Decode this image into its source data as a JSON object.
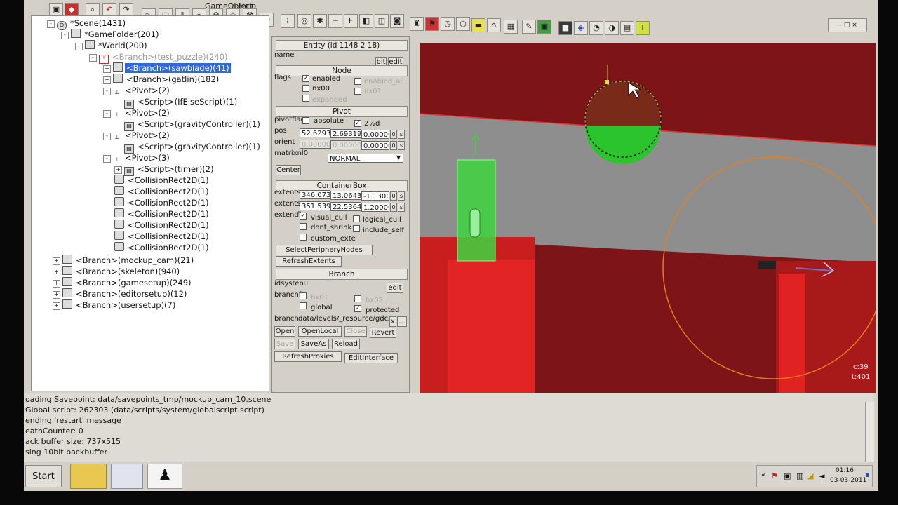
{
  "menu": {
    "gameobject": "GameObject",
    "help": "Help"
  },
  "tree": {
    "nodes": [
      {
        "label": "*Scene(1431)"
      },
      {
        "label": "*GameFolder(201)"
      },
      {
        "label": "*World(200)"
      },
      {
        "label": "<Branch>(test_puzzle)(240)"
      },
      {
        "label": "<Branch>(sawblade)(41)"
      },
      {
        "label": "<Branch>(gatlin)(182)"
      },
      {
        "label": "<Pivot>(2)"
      },
      {
        "label": "<Script>(IfElseScript)(1)"
      },
      {
        "label": "<Pivot>(2)"
      },
      {
        "label": "<Script>(gravityController)(1)"
      },
      {
        "label": "<Pivot>(2)"
      },
      {
        "label": "<Script>(gravityController)(1)"
      },
      {
        "label": "<Pivot>(3)"
      },
      {
        "label": "<Script>(timer)(2)"
      },
      {
        "label": "<CollisionRect2D(1)"
      },
      {
        "label": "<CollisionRect2D(1)"
      },
      {
        "label": "<CollisionRect2D(1)"
      },
      {
        "label": "<CollisionRect2D(1)"
      },
      {
        "label": "<CollisionRect2D(1)"
      },
      {
        "label": "<CollisionRect2D(1)"
      },
      {
        "label": "<CollisionRect2D(1)"
      },
      {
        "label": "<Branch>(mockup_cam)(21)"
      },
      {
        "label": "<Branch>(skeleton)(940)"
      },
      {
        "label": "<Branch>(gamesetup)(249)"
      },
      {
        "label": "<Branch>(editorsetup)(12)"
      },
      {
        "label": "<Branch>(usersetup)(7)"
      }
    ]
  },
  "props": {
    "entity_title": "Entity (id 1148 2 18)",
    "name_label": "name",
    "bit_btn": "bit",
    "edit_btn": "edit",
    "node_hdr": "Node",
    "flags_label": "flags",
    "enabled": "enabled",
    "enabled_all": "enabled_all",
    "nx00": "nx00",
    "nx01": "nx01",
    "expanded": "expanded",
    "pivot_hdr": "Pivot",
    "pivotflag_label": "pivotflag",
    "absolute": "absolute",
    "is2d": "2½d",
    "pos_label": "pos",
    "pos": [
      "52.6293",
      "2.69319",
      "0.00000"
    ],
    "orient_label": "orient",
    "orient": [
      "0.00000",
      "0.00000",
      "0.00000"
    ],
    "matrix_label": "matrixnl0",
    "matrix_value": "NORMAL",
    "center_btn": "Center",
    "container_hdr": "ContainerBox",
    "extents_label_1": "extentsr",
    "extents_1": [
      "346.073",
      "13.0643",
      "-1.13000"
    ],
    "extents_label_2": "extentsr",
    "extents_2": [
      "351.539",
      "22.5364",
      "1.20000"
    ],
    "extentfl_label": "extentfl",
    "visual_cull": "visual_cull",
    "logical_cull": "logical_cull",
    "dont_shrink": "dont_shrink",
    "include_self": "include_self",
    "custom_exte": "custom_exte",
    "select_periphery_btn": "SelectPeripheryNodes",
    "refresh_extents_btn": "RefreshExtents",
    "branch_hdr": "Branch",
    "idsystem_label": "idsysten",
    "idsystem_value": "10",
    "edit_btn2": "edit",
    "branchf_label": "branchf",
    "bx01": "bx01",
    "bx02": "bx02",
    "global": "global",
    "protected": "protected",
    "branch_label": "branch",
    "branch_path": "data/levels/_resource/gdc/",
    "x_btn": "x",
    "dots_btn": "...",
    "open_btn": "Open",
    "open_local_btn": "OpenLocal",
    "close_btn": "Close",
    "revert_btn": "Revert",
    "save_btn": "Save",
    "save_as_btn": "SaveAs",
    "reload_btn": "Reload",
    "refresh_proxies_btn": "RefreshProxies",
    "edit_interface_btn": "EditInterface",
    "s_btn": "s",
    "zero_btn": "0"
  },
  "viewport": {
    "stat1": "c:39",
    "stat2": "t:401"
  },
  "console": {
    "lines": [
      "oading Savepoint: data/savepoints_tmp/mockup_cam_10.scene",
      "Global script: 262303   (data/scripts/system/globalscript.script)",
      "ending 'restart' message",
      "eathCounter: 0",
      "ack buffer size: 737x515",
      "sing 10bit backbuffer"
    ]
  },
  "taskbar": {
    "start": "Start",
    "time": "01:16",
    "date": "03-03-2011"
  },
  "icons": {
    "expand": "+",
    "collapse": "-",
    "check": "✓"
  }
}
